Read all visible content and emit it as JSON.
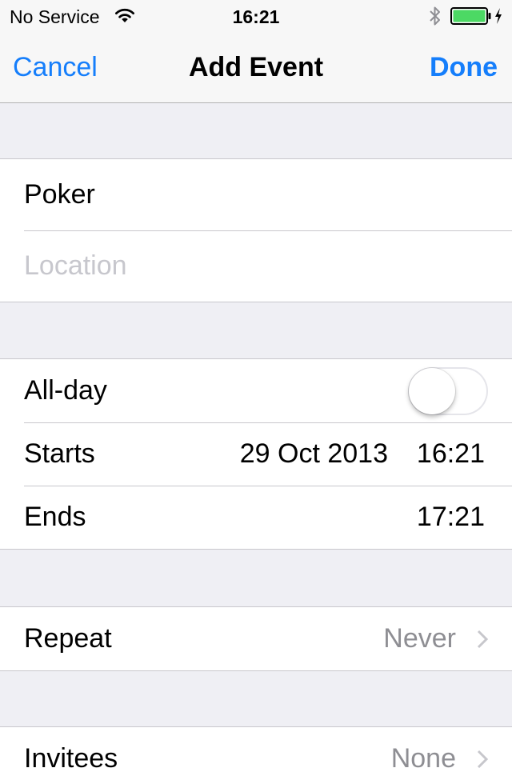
{
  "status_bar": {
    "carrier": "No Service",
    "time": "16:21",
    "wifi_icon": "wifi-icon",
    "bluetooth_icon": "bluetooth-icon",
    "battery_icon": "battery-icon",
    "charging_icon": "charging-bolt-icon",
    "battery_level": 1.0,
    "battery_color": "#4cd964"
  },
  "nav": {
    "cancel_label": "Cancel",
    "title": "Add Event",
    "done_label": "Done",
    "accent_color": "#157efb"
  },
  "details": {
    "title_value": "Poker",
    "location_placeholder": "Location"
  },
  "timing": {
    "all_day_label": "All-day",
    "all_day_on": false,
    "starts_label": "Starts",
    "starts_date": "29 Oct 2013",
    "starts_time": "16:21",
    "ends_label": "Ends",
    "ends_time": "17:21"
  },
  "repeat": {
    "label": "Repeat",
    "value": "Never",
    "chevron_icon": "chevron-right-icon"
  },
  "invitees": {
    "label": "Invitees",
    "value": "None",
    "chevron_icon": "chevron-right-icon"
  }
}
